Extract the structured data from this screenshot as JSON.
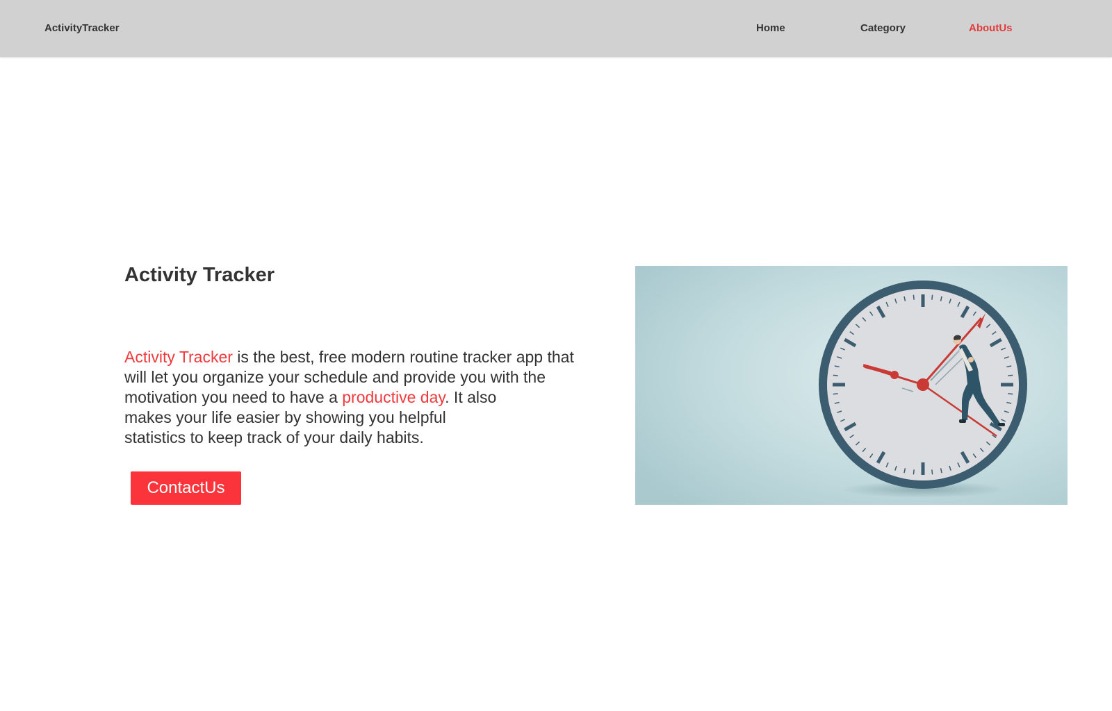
{
  "navbar": {
    "brand": "ActivityTracker",
    "links": [
      {
        "label": "Home",
        "active": false
      },
      {
        "label": "Category",
        "active": false
      },
      {
        "label": "AboutUs",
        "active": true
      }
    ]
  },
  "hero": {
    "title": "Activity Tracker",
    "text": {
      "highlight_1": "Activity Tracker",
      "part_1": " is the best, free modern routine tracker app that",
      "line_2": "will let you organize your schedule and provide you with the",
      "part_3a": "motivation you need to have a ",
      "highlight_2": "productive day",
      "part_3b": ". It also",
      "line_4": "makes your life easier by showing you helpful",
      "line_5": "statistics to keep track of your daily habits."
    },
    "button_label": "ContactUs",
    "image_icon": "clock-with-climbing-businessman-illustration"
  },
  "colors": {
    "navbar_bg": "#d1d1d1",
    "accent": "#f0393c",
    "button_bg": "#fb333a",
    "text": "#333333",
    "image_bg": "#b9d5d8",
    "clock_rim": "#3c5c70"
  }
}
